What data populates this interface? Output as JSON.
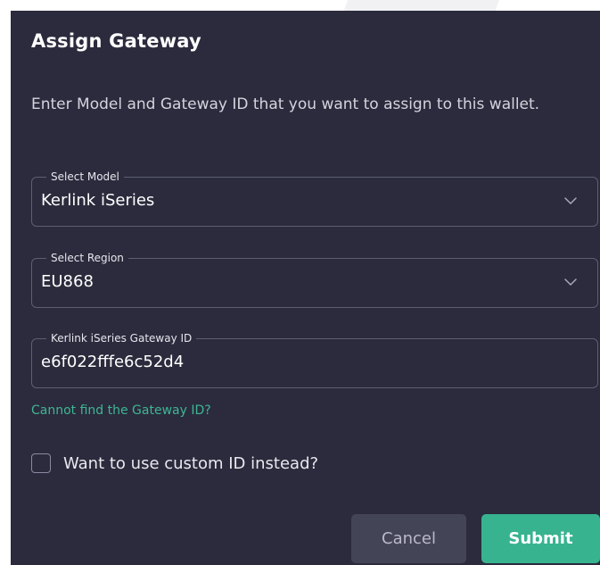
{
  "dialog": {
    "title": "Assign Gateway",
    "description": "Enter Model and Gateway ID that you want to assign to this wallet."
  },
  "fields": {
    "model": {
      "label": "Select Model",
      "value": "Kerlink iSeries",
      "icon": "chevron-down-icon"
    },
    "region": {
      "label": "Select Region",
      "value": "EU868",
      "icon": "chevron-down-icon"
    },
    "gateway_id": {
      "label": "Kerlink iSeries Gateway ID",
      "value": "e6f022fffe6c52d4"
    }
  },
  "helper_link": "Cannot find the Gateway ID?",
  "checkbox": {
    "label": "Want to use custom ID instead?",
    "checked": false
  },
  "buttons": {
    "cancel": "Cancel",
    "submit": "Submit"
  },
  "colors": {
    "dialog_background": "#2b2b3d",
    "accent": "#37b38f",
    "link": "#3fb594",
    "field_border": "#5e5e74",
    "cancel_background": "#444457"
  }
}
